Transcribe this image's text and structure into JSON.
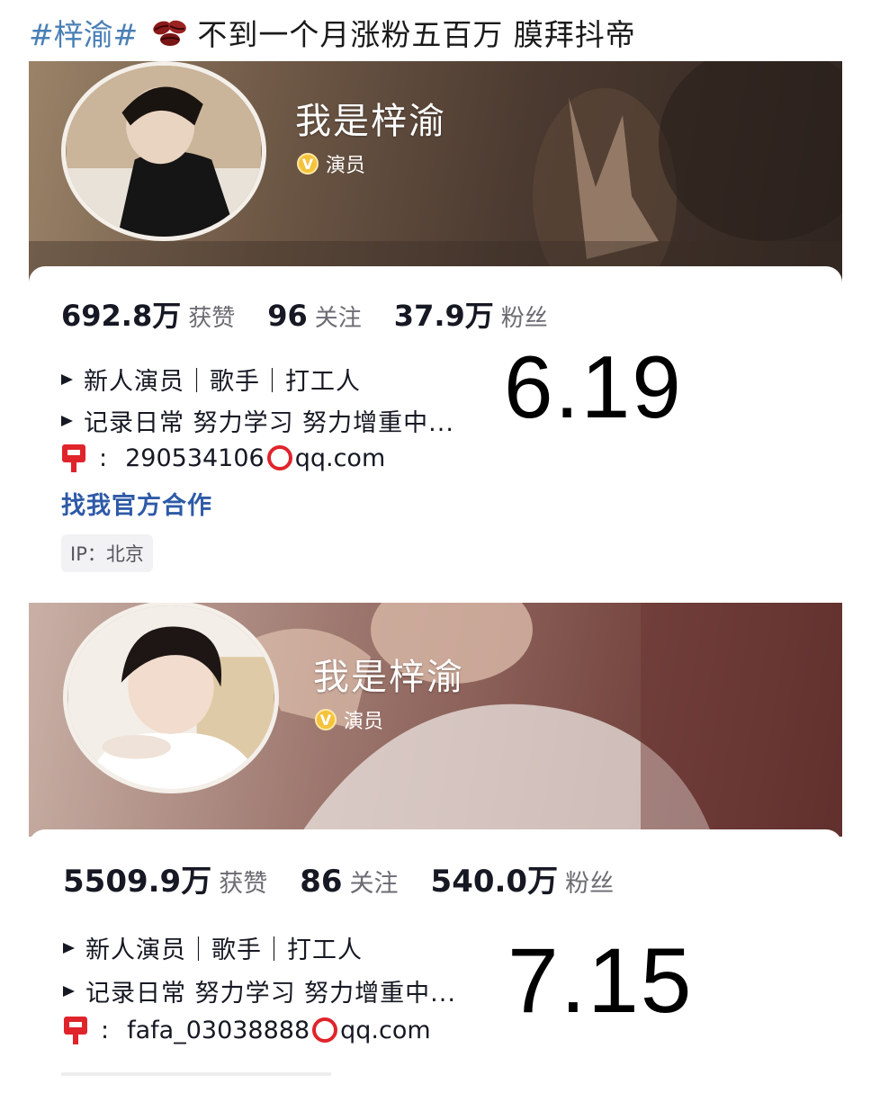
{
  "post": {
    "hashtag": "#梓渝#",
    "emoji_icon": "coffee-beans-icon",
    "text": "不到一个月涨粉五百万 膜拜抖帝"
  },
  "profiles": [
    {
      "nickname": "我是梓渝",
      "role": "演员",
      "badge_icon": "verified-v-icon",
      "stats": [
        {
          "value": "692.8万",
          "label": "获赞"
        },
        {
          "value": "96",
          "label": "关注"
        },
        {
          "value": "37.9万",
          "label": "粉丝"
        }
      ],
      "bio": [
        "新人演员｜歌手｜打工人",
        "记录日常 努力学习 努力增重中..."
      ],
      "email_prefix": "290534106",
      "email_suffix": "qq.com",
      "business_link": "找我官方合作",
      "ip_label": "IP：北京",
      "date_annotation": "6.19"
    },
    {
      "nickname": "我是梓渝",
      "role": "演员",
      "badge_icon": "verified-v-icon",
      "stats": [
        {
          "value": "5509.9万",
          "label": "获赞"
        },
        {
          "value": "86",
          "label": "关注"
        },
        {
          "value": "540.0万",
          "label": "粉丝"
        }
      ],
      "bio": [
        "新人演员｜歌手｜打工人",
        "记录日常 努力学习 努力增重中..."
      ],
      "email_prefix": "fafa_03038888",
      "email_suffix": "qq.com",
      "date_annotation": "7.15"
    }
  ],
  "colors": {
    "hashtag": "#4a7fb5",
    "link": "#2e5aa7",
    "badge": "#f5c23b",
    "mail_red": "#e0242b"
  }
}
